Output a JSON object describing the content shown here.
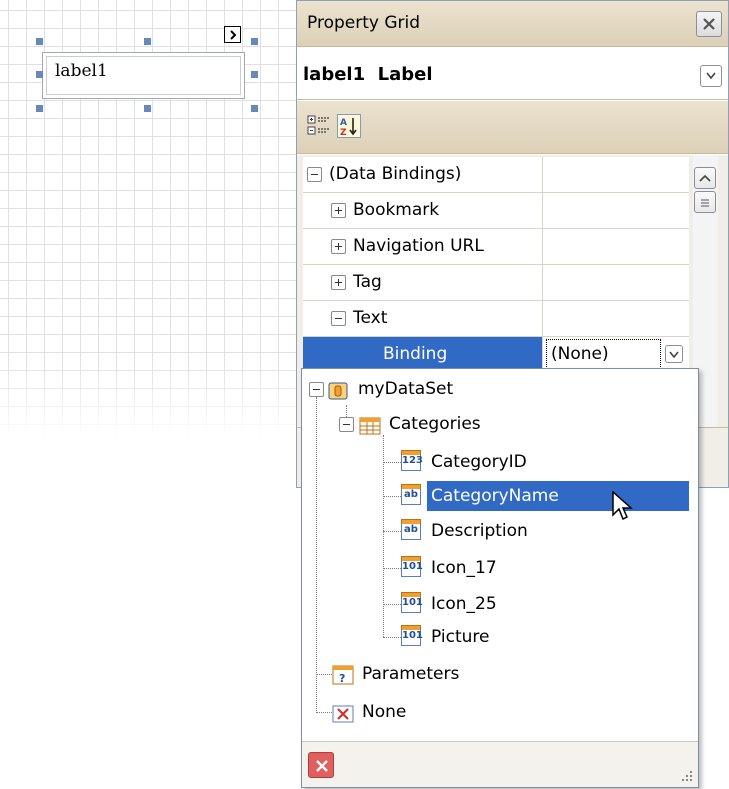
{
  "designer": {
    "label_text": "label1"
  },
  "property_grid": {
    "title": "Property Grid",
    "selected_object": "label1  Label",
    "rows": [
      {
        "name": "(Data Bindings)",
        "expander": "minus",
        "value": ""
      },
      {
        "name": "Bookmark",
        "expander": "plus",
        "value": ""
      },
      {
        "name": "Navigation URL",
        "expander": "plus",
        "value": ""
      },
      {
        "name": "Tag",
        "expander": "plus",
        "value": ""
      },
      {
        "name": "Text",
        "expander": "minus",
        "value": ""
      },
      {
        "name": "Binding",
        "expander": "none",
        "value": "(None)"
      }
    ]
  },
  "binding_popup": {
    "tree": {
      "datasource": "myDataSet",
      "table": "Categories",
      "fields": [
        {
          "name": "CategoryID",
          "icon": "123"
        },
        {
          "name": "CategoryName",
          "icon": "ab"
        },
        {
          "name": "Description",
          "icon": "ab"
        },
        {
          "name": "Icon_17",
          "icon": "101"
        },
        {
          "name": "Icon_25",
          "icon": "101"
        },
        {
          "name": "Picture",
          "icon": "101"
        }
      ],
      "parameters": "Parameters",
      "none": "None"
    },
    "selected_field": "CategoryName"
  },
  "colors": {
    "selection": "#316ac5",
    "window_header": "#e4dac3",
    "clear_button": "#e06060"
  }
}
